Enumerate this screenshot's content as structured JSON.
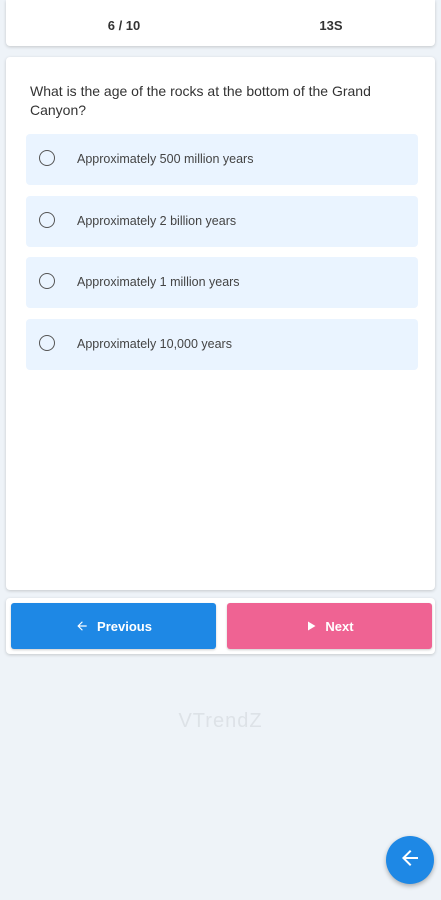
{
  "header": {
    "progress": "6 / 10",
    "timer": "13S"
  },
  "question": {
    "text": "What is the age of the rocks at the bottom of the Grand Canyon?",
    "options": [
      "Approximately 500 million years",
      "Approximately 2 billion years",
      "Approximately 1 million years",
      "Approximately 10,000 years"
    ]
  },
  "navigation": {
    "previous_label": "Previous",
    "next_label": "Next",
    "previous_icon": "arrow-left-icon",
    "next_icon": "play-icon"
  },
  "brand": {
    "name": "VTrendZ"
  },
  "fab": {
    "icon": "arrow-left-icon"
  },
  "colors": {
    "background": "#eef3f8",
    "option_background": "#eaf4ff",
    "previous_button": "#1e88e5",
    "next_button": "#ef6393",
    "fab": "#1e88e5"
  }
}
